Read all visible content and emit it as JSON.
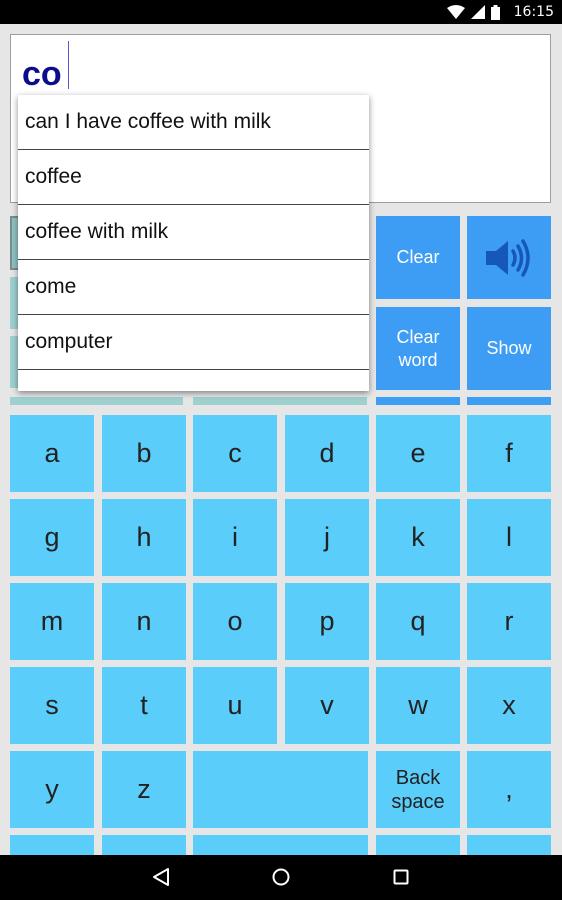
{
  "status_bar": {
    "time": "16:15"
  },
  "text_field": {
    "value": "co"
  },
  "actions": {
    "clear": "Clear",
    "clear_word_line1": "Clear",
    "clear_word_line2": "word",
    "show": "Show",
    "speak_icon": "speaker-icon"
  },
  "suggestions": [
    "can I have coffee with milk",
    "coffee",
    "coffee with milk",
    "come",
    "computer"
  ],
  "keyboard": {
    "row1": [
      "a",
      "b",
      "c",
      "d",
      "e",
      "f"
    ],
    "row2": [
      "g",
      "h",
      "i",
      "j",
      "k",
      "l"
    ],
    "row3": [
      "m",
      "n",
      "o",
      "p",
      "q",
      "r"
    ],
    "row4": [
      "s",
      "t",
      "u",
      "v",
      "w",
      "x"
    ],
    "row5": [
      "y",
      "z",
      "",
      "",
      ","
    ],
    "backspace_line1": "Back",
    "backspace_line2": "space"
  },
  "colors": {
    "key": "#5bcdfa",
    "action_button": "#3d9df5",
    "typed_text": "#0d0d8c"
  }
}
